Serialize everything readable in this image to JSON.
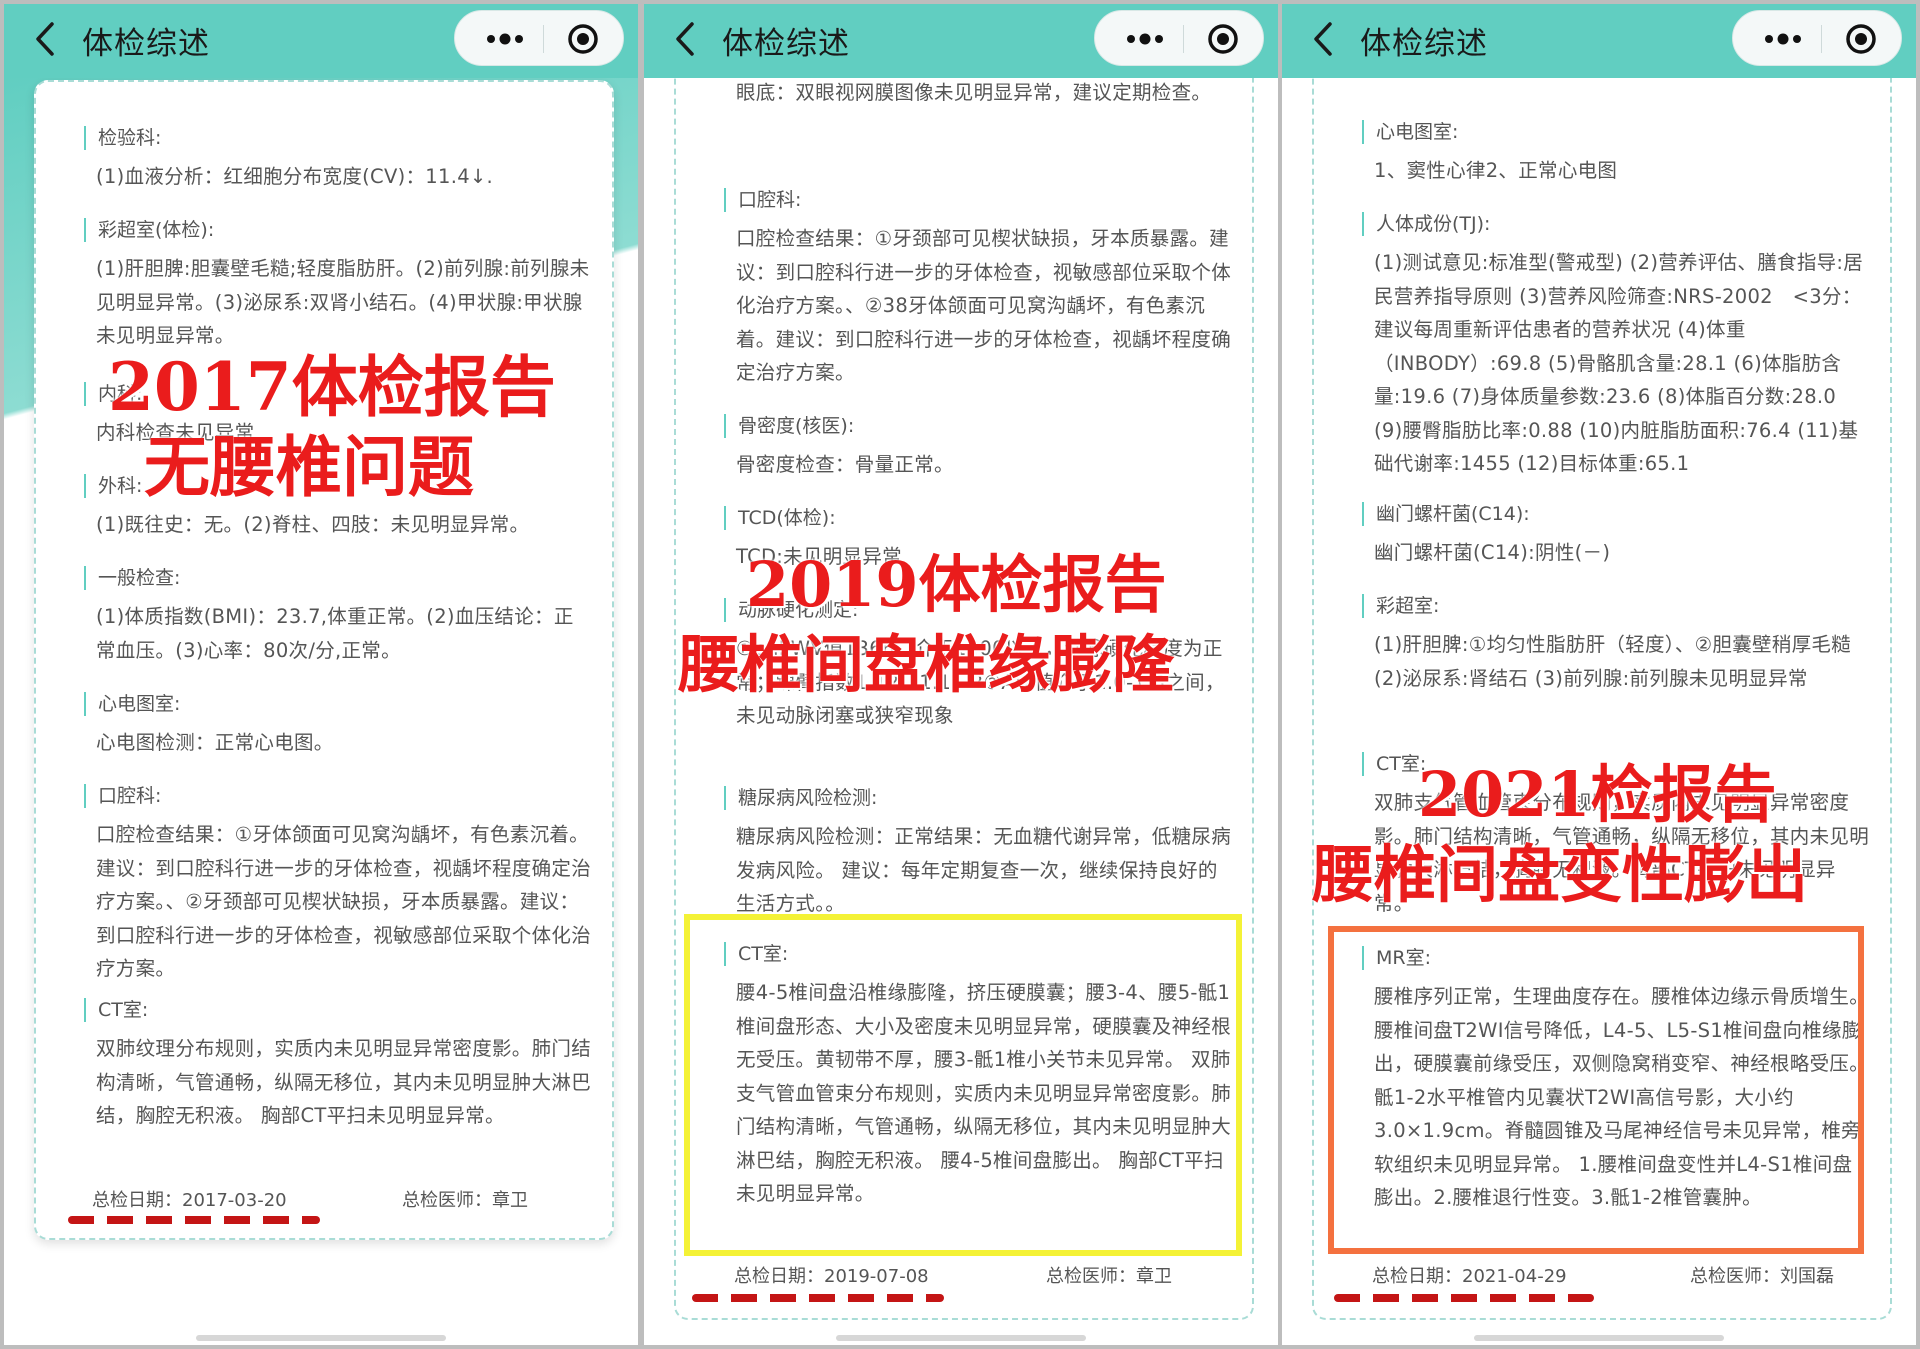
{
  "panels": [
    {
      "app_title": "体检综述",
      "sections": [
        {
          "title": "检验科:",
          "text": "(1)血液分析：红细胞分布宽度(CV)：11.4↓."
        },
        {
          "title": "彩超室(体检):",
          "text": "(1)肝胆脾:胆囊壁毛糙;轻度脂肪肝。(2)前列腺:前列腺未见明显异常。(3)泌尿系:双肾小结石。(4)甲状腺:甲状腺未见明显异常。"
        },
        {
          "title": "内科:",
          "text": "内科检查未见异常"
        },
        {
          "title": "外科:",
          "text": "(1)既往史：无。(2)脊柱、四肢：未见明显异常。"
        },
        {
          "title": "一般检查:",
          "text": "(1)体质指数(BMI)：23.7,体重正常。(2)血压结论：正常血压。(3)心率：80次/分,正常。"
        },
        {
          "title": "心电图室:",
          "text": "心电图检测：正常心电图。"
        },
        {
          "title": "口腔科:",
          "text": "口腔检查结果：①牙体颌面可见窝沟龋坏，有色素沉着。建议：到口腔科行进一步的牙体检查，视龋坏程度确定治疗方案。、②牙颈部可见楔状缺损，牙本质暴露。建议：到口腔科行进一步的牙体检查，视敏感部位采取个体化治疗方案。"
        },
        {
          "title": "CT室:",
          "text": "双肺纹理分布规则，实质内未见明显异常密度影。肺门结构清晰，气管通畅，纵隔无移位，其内未见明显肿大淋巴结，胸腔无积液。 胸部CT平扫未见明显异常。"
        }
      ],
      "date_label": "总检日期：2017-03-20",
      "doctor_label": "总检医师：章卫",
      "overlay_line1": "2017体检报告",
      "overlay_line2": "无腰椎问题"
    },
    {
      "app_title": "体检综述",
      "sections": [
        {
          "title": "",
          "text": "眼底：双眼视网膜图像未见明显异常，建议定期检查。"
        },
        {
          "title": "口腔科:",
          "text": "口腔检查结果：①牙颈部可见楔状缺损，牙本质暴露。建议：到口腔科行进一步的牙体检查，视敏感部位采取个体化治疗方案。、②38牙体颌面可见窝沟龋坏，有色素沉着。建议：到口腔科行进一步的牙体检查，视龋坏程度确定治疗方案。"
        },
        {
          "title": "骨密度(核医):",
          "text": "骨密度检查：骨量正常。"
        },
        {
          "title": "TCD(体检):",
          "text": "TCD:未见明显异常"
        },
        {
          "title": "动脉硬化测定:",
          "text": "①baPWV值1366，介于1400以下，动脉硬化程度为正常；踝臂指数1.12、1.1，2②ABI值介于1.0-1.3之间，未见动脉闭塞或狭窄现象"
        },
        {
          "title": "糖尿病风险检测:",
          "text": "糖尿病风险检测：正常结果：无血糖代谢异常，低糖尿病发病风险。 建议：每年定期复查一次，继续保持良好的生活方式。。"
        },
        {
          "title": "CT室:",
          "text": "腰4-5椎间盘沿椎缘膨隆，挤压硬膜囊；腰3-4、腰5-骶1椎间盘形态、大小及密度未见明显异常，硬膜囊及神经根无受压。黄韧带不厚，腰3-骶1椎小关节未见异常。 双肺支气管血管束分布规则，实质内未见明显异常密度影。肺门结构清晰，气管通畅，纵隔无移位，其内未见明显肿大淋巴结，胸腔无积液。 腰4-5椎间盘膨出。 胸部CT平扫未见明显异常。"
        }
      ],
      "date_label": "总检日期：2019-07-08",
      "doctor_label": "总检医师：章卫",
      "overlay_line1": "2019体检报告",
      "overlay_line2": "腰椎间盘椎缘膨隆"
    },
    {
      "app_title": "体检综述",
      "sections": [
        {
          "title": "心电图室:",
          "text": "1、窦性心律2、正常心电图"
        },
        {
          "title": "人体成份(TJ):",
          "text": "(1)测试意见:标准型(警戒型) (2)营养评估、膳食指导:居民营养指导原则 (3)营养风险筛查:NRS-2002　<3分：建议每周重新评估患者的营养状况 (4)体重（INBODY）:69.8 (5)骨骼肌含量:28.1 (6)体脂肪含量:19.6 (7)身体质量参数:23.6 (8)体脂百分数:28.0 (9)腰臀脂肪比率:0.88 (10)内脏脂肪面积:76.4 (11)基础代谢率:1455 (12)目标体重:65.1"
        },
        {
          "title": "幽门螺杆菌(C14):",
          "text": "幽门螺杆菌(C14):阴性(－)"
        },
        {
          "title": "彩超室:",
          "text": "(1)肝胆脾:①均匀性脂肪肝（轻度）、②胆囊壁稍厚毛糙 (2)泌尿系:肾结石 (3)前列腺:前列腺未见明显异常"
        },
        {
          "title": "CT室:",
          "text": "双肺支气管血管束分布规则，实质内未见明显异常密度影。肺门结构清晰，气管通畅，纵隔无移位，其内未见明显肿大淋巴结，胸腔无积液。胸部CT平扫未见明显异常。"
        },
        {
          "title": "MR室:",
          "text": "腰椎序列正常，生理曲度存在。腰椎体边缘示骨质增生。腰椎间盘T2WI信号降低，L4-5、L5-S1椎间盘向椎缘膨出，硬膜囊前缘受压，双侧隐窝稍变窄、神经根略受压。骶1-2水平椎管内见囊状T2WI高信号影，大小约3.0×1.9cm。脊髓圆锥及马尾神经信号未见异常，椎旁软组织未见明显异常。 1.腰椎间盘变性并L4-S1椎间盘膨出。2.腰椎退行性变。3.骶1-2椎管囊肿。"
        }
      ],
      "date_label": "总检日期：2021-04-29",
      "doctor_label": "总检医师：刘国磊",
      "overlay_line1": "2021检报告",
      "overlay_line2": "腰椎间盘变性膨出"
    }
  ],
  "icons": [
    "back-arrow-icon",
    "more-dots-icon",
    "close-circle-icon"
  ],
  "colors": {
    "appbar": "#61cec1",
    "overlay_text": "#ea1c1c",
    "highlight_yellow": "#f4f236",
    "highlight_orange": "#f4713f",
    "dash_underline": "#c41515"
  }
}
